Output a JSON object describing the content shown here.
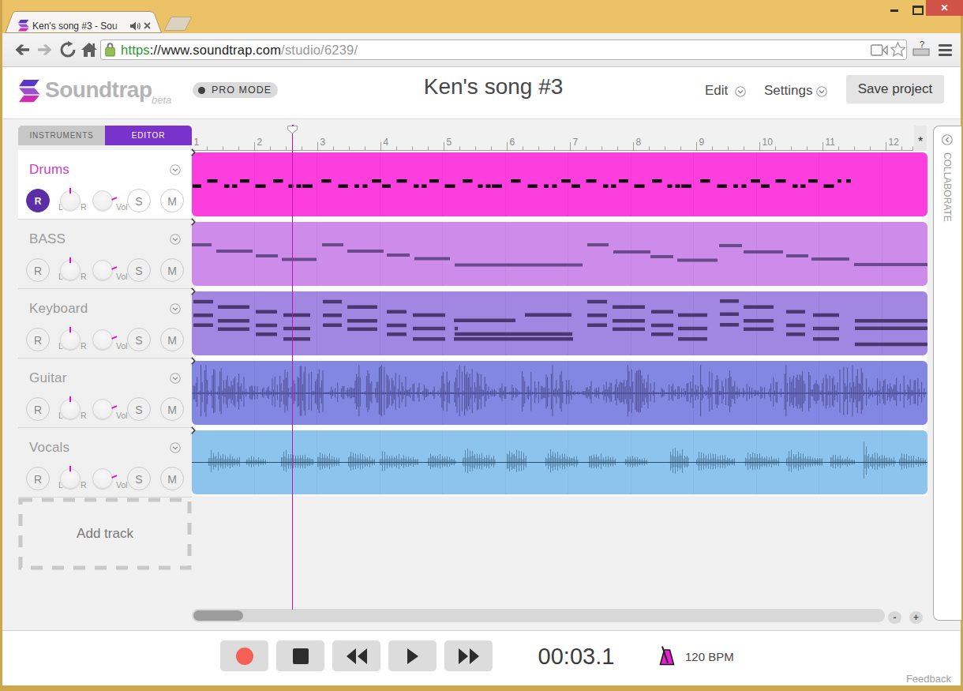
{
  "window": {
    "tab_title": "Ken's song #3 - Sou",
    "minimize": "minimize",
    "maximize": "maximize",
    "close": "✕"
  },
  "browser": {
    "url_scheme": "https",
    "url_host": "://www.soundtrap.com",
    "url_path": "/studio/6239/"
  },
  "header": {
    "brand": "Soundtrap",
    "brand_suffix": "beta",
    "pro_mode": "PRO MODE",
    "song_title": "Ken's song #3",
    "edit": "Edit",
    "settings": "Settings",
    "save": "Save project"
  },
  "sidebar": {
    "tab_instruments": "INSTRUMENTS",
    "tab_editor": "EDITOR",
    "add_track": "Add track",
    "controls": {
      "record": "R",
      "pan_left": "L",
      "pan_right": "R",
      "vol": "Vol",
      "solo": "S",
      "mute": "M"
    },
    "tracks": [
      {
        "name": "Drums",
        "selected": true,
        "rec": true,
        "color": "#fb3edd"
      },
      {
        "name": "BASS",
        "selected": false,
        "rec": false,
        "color": "#cd8ce9"
      },
      {
        "name": "Keyboard",
        "selected": false,
        "rec": false,
        "color": "#a186e2"
      },
      {
        "name": "Guitar",
        "selected": false,
        "rec": false,
        "color": "#8287e2"
      },
      {
        "name": "Vocals",
        "selected": false,
        "rec": false,
        "color": "#8dc4ee"
      }
    ]
  },
  "timeline": {
    "bar_numbers": [
      "1",
      "2",
      "3",
      "4",
      "5",
      "6",
      "7",
      "8",
      "9",
      "10",
      "11",
      "12"
    ],
    "star": "*",
    "collaborate": "COLLABORATE"
  },
  "transport": {
    "time": "00:03.1",
    "bpm": "120 BPM",
    "feedback": "Feedback"
  },
  "clips": {
    "drums": {
      "tile": 240,
      "rows": [
        34,
        40.5
      ],
      "dash_h": 4.3,
      "max_x": 813,
      "tail": [
        [
          818,
          0,
          5
        ],
        [
          829,
          0,
          6
        ]
      ],
      "unit": [
        [
          1,
          1,
          11
        ],
        [
          19.5,
          0,
          13
        ],
        [
          41,
          1,
          6.5
        ],
        [
          51,
          1,
          6.5
        ],
        [
          61,
          0,
          12
        ],
        [
          80.5,
          1,
          13
        ],
        [
          103,
          0,
          12.5
        ],
        [
          122.5,
          1,
          6
        ],
        [
          132.5,
          1,
          6
        ],
        [
          140,
          1,
          13
        ],
        [
          164,
          0,
          12.5
        ],
        [
          185.5,
          1,
          12.5
        ],
        [
          206,
          1,
          6
        ],
        [
          216.5,
          1,
          6
        ],
        [
          228,
          0,
          12
        ]
      ]
    },
    "bass_notes": [
      [
        0,
        25,
        27
      ],
      [
        31,
        46,
        35
      ],
      [
        81,
        28,
        41
      ],
      [
        114,
        44,
        45.5
      ],
      [
        165,
        27,
        27
      ],
      [
        197,
        46,
        35
      ],
      [
        247,
        29,
        40
      ],
      [
        282,
        45,
        44.5
      ],
      [
        333,
        162,
        52.5
      ],
      [
        501,
        27,
        27
      ],
      [
        534,
        47,
        36
      ],
      [
        581,
        29,
        42
      ],
      [
        615,
        51,
        46.5
      ],
      [
        668,
        29,
        28
      ],
      [
        699,
        50,
        36
      ],
      [
        753,
        28,
        41
      ],
      [
        785,
        48,
        45
      ],
      [
        839,
        93,
        52
      ]
    ],
    "keys_notes": [
      [
        2,
        25,
        10.8
      ],
      [
        2,
        25,
        28
      ],
      [
        2,
        25,
        40.6
      ],
      [
        33,
        40,
        17.6
      ],
      [
        33,
        40,
        35
      ],
      [
        33,
        40,
        45.4
      ],
      [
        81,
        27,
        23.5
      ],
      [
        81,
        27,
        40.8
      ],
      [
        81,
        27,
        51.9
      ],
      [
        116,
        34,
        27.7
      ],
      [
        116,
        34,
        44.7
      ],
      [
        116,
        34,
        58
      ],
      [
        166,
        24,
        10.8
      ],
      [
        166,
        24,
        28
      ],
      [
        166,
        24,
        40.6
      ],
      [
        197,
        38,
        17.6
      ],
      [
        197,
        38,
        35
      ],
      [
        197,
        38,
        45.4
      ],
      [
        247,
        25,
        23.5
      ],
      [
        247,
        25,
        40.8
      ],
      [
        247,
        25,
        51.9
      ],
      [
        280,
        41,
        27.7
      ],
      [
        280,
        41,
        44.7
      ],
      [
        280,
        41,
        58
      ],
      [
        332,
        78,
        34.4
      ],
      [
        422,
        59,
        27.6
      ],
      [
        333,
        4,
        44.7
      ],
      [
        333,
        149,
        51.8
      ],
      [
        332,
        151,
        58.1
      ],
      [
        501,
        25,
        10.8
      ],
      [
        501,
        25,
        28
      ],
      [
        501,
        25,
        40.6
      ],
      [
        533,
        41,
        17.6
      ],
      [
        533,
        41,
        35
      ],
      [
        533,
        41,
        45.4
      ],
      [
        582,
        28,
        23.5
      ],
      [
        582,
        28,
        40.8
      ],
      [
        582,
        28,
        51.9
      ],
      [
        616,
        37,
        27.7
      ],
      [
        616,
        37,
        44.7
      ],
      [
        616,
        37,
        58
      ],
      [
        669,
        24,
        9.9
      ],
      [
        669,
        24,
        26.6
      ],
      [
        669,
        24,
        40
      ],
      [
        699,
        38,
        17.6
      ],
      [
        699,
        38,
        35
      ],
      [
        699,
        38,
        45.4
      ],
      [
        753,
        24,
        23.5
      ],
      [
        753,
        24,
        40.8
      ],
      [
        753,
        24,
        51.9
      ],
      [
        787,
        33,
        27.7
      ],
      [
        787,
        33,
        44.7
      ],
      [
        787,
        33,
        58
      ],
      [
        840,
        92,
        35
      ],
      [
        840,
        92,
        44.4
      ],
      [
        840,
        92,
        64.7
      ]
    ],
    "guitar_bursts": [
      [
        2,
        67,
        27
      ],
      [
        67,
        102,
        9
      ],
      [
        102,
        172,
        28
      ],
      [
        172,
        207,
        8
      ],
      [
        207,
        272,
        26
      ],
      [
        272,
        312,
        10
      ],
      [
        312,
        377,
        25
      ],
      [
        377,
        417,
        10
      ],
      [
        417,
        482,
        26
      ],
      [
        482,
        522,
        8
      ],
      [
        522,
        587,
        24
      ],
      [
        587,
        627,
        9
      ],
      [
        627,
        692,
        26
      ],
      [
        692,
        732,
        10
      ],
      [
        732,
        797,
        23
      ],
      [
        797,
        867,
        25
      ],
      [
        867,
        930,
        22
      ]
    ],
    "vocal_bursts": [
      [
        20,
        62,
        13
      ],
      [
        68,
        95,
        8
      ],
      [
        112,
        155,
        14
      ],
      [
        158,
        188,
        13
      ],
      [
        197,
        232,
        14
      ],
      [
        237,
        288,
        12
      ],
      [
        298,
        335,
        12
      ],
      [
        342,
        385,
        16
      ],
      [
        398,
        425,
        19
      ],
      [
        447,
        490,
        15
      ],
      [
        502,
        538,
        13
      ],
      [
        548,
        578,
        10
      ],
      [
        605,
        630,
        22
      ],
      [
        638,
        688,
        13
      ],
      [
        700,
        745,
        12
      ],
      [
        752,
        800,
        14
      ],
      [
        808,
        840,
        10
      ],
      [
        850,
        858,
        30
      ],
      [
        858,
        892,
        13
      ],
      [
        895,
        930,
        10
      ]
    ]
  }
}
